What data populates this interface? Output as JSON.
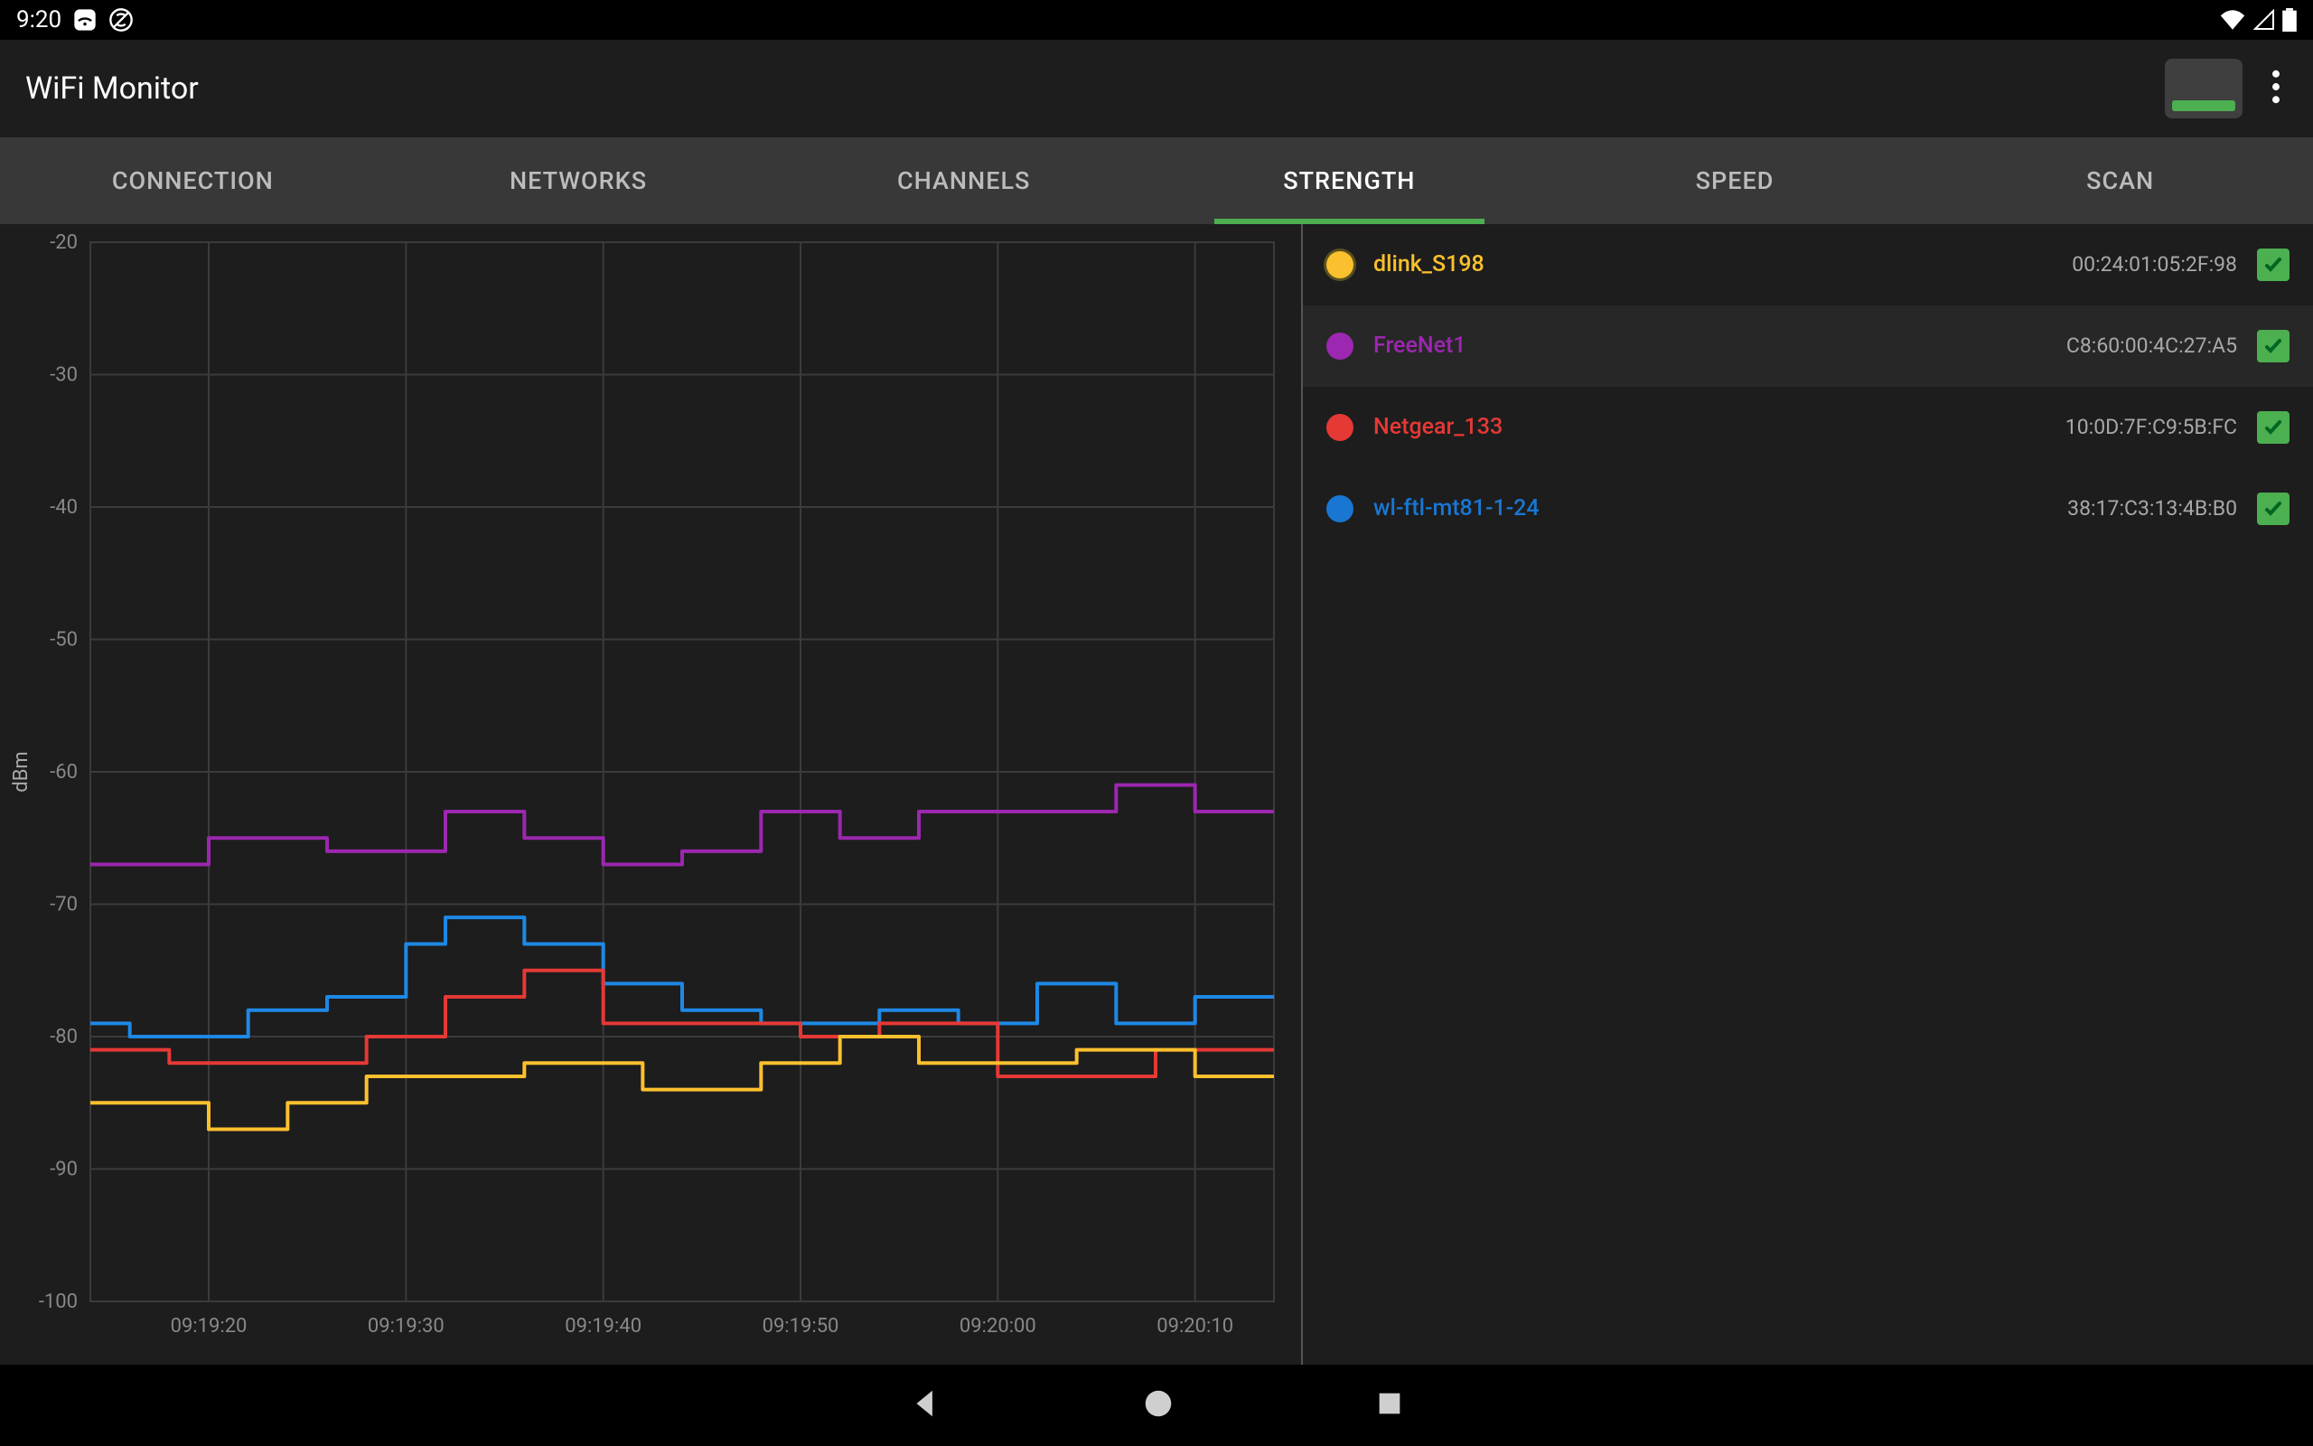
{
  "statusbar": {
    "time": "9:20"
  },
  "appbar": {
    "title": "WiFi Monitor"
  },
  "tabs": [
    {
      "id": "connection",
      "label": "CONNECTION",
      "active": false
    },
    {
      "id": "networks",
      "label": "NETWORKS",
      "active": false
    },
    {
      "id": "channels",
      "label": "CHANNELS",
      "active": false
    },
    {
      "id": "strength",
      "label": "STRENGTH",
      "active": true
    },
    {
      "id": "speed",
      "label": "SPEED",
      "active": false
    },
    {
      "id": "scan",
      "label": "SCAN",
      "active": false
    }
  ],
  "networks": [
    {
      "name": "dlink_S198",
      "mac": "00:24:01:05:2F:98",
      "color": "#fbc02d",
      "checked": true,
      "selected": false,
      "highlight": true
    },
    {
      "name": "FreeNet1",
      "mac": "C8:60:00:4C:27:A5",
      "color": "#9c27b0",
      "checked": true,
      "selected": true,
      "highlight": false
    },
    {
      "name": "Netgear_133",
      "mac": "10:0D:7F:C9:5B:FC",
      "color": "#e53935",
      "checked": true,
      "selected": false,
      "highlight": false
    },
    {
      "name": "wl-ftl-mt81-1-24",
      "mac": "38:17:C3:13:4B:B0",
      "color": "#1976d2",
      "checked": true,
      "selected": false,
      "highlight": false
    }
  ],
  "chart_data": {
    "type": "line",
    "title": "",
    "xlabel": "",
    "ylabel": "dBm",
    "ylim": [
      -100,
      -20
    ],
    "x": [
      "09:19:14",
      "09:19:16",
      "09:19:18",
      "09:19:20",
      "09:19:22",
      "09:19:24",
      "09:19:26",
      "09:19:28",
      "09:19:30",
      "09:19:32",
      "09:19:34",
      "09:19:36",
      "09:19:38",
      "09:19:40",
      "09:19:42",
      "09:19:44",
      "09:19:46",
      "09:19:48",
      "09:19:50",
      "09:19:52",
      "09:19:54",
      "09:19:56",
      "09:19:58",
      "09:20:00",
      "09:20:02",
      "09:20:04",
      "09:20:06",
      "09:20:08",
      "09:20:10",
      "09:20:12",
      "09:20:14"
    ],
    "x_ticks": [
      "09:19:20",
      "09:19:30",
      "09:19:40",
      "09:19:50",
      "09:20:00",
      "09:20:10"
    ],
    "y_ticks": [
      -20,
      -30,
      -40,
      -50,
      -60,
      -70,
      -80,
      -90,
      -100
    ],
    "series": [
      {
        "name": "FreeNet1",
        "color": "#9c27b0",
        "values": [
          -67,
          -67,
          -67,
          -65,
          -65,
          -65,
          -66,
          -66,
          -66,
          -63,
          -63,
          -65,
          -65,
          -67,
          -67,
          -66,
          -66,
          -63,
          -63,
          -65,
          -65,
          -63,
          -63,
          -63,
          -63,
          -63,
          -61,
          -61,
          -63,
          -63,
          -63
        ]
      },
      {
        "name": "wl-ftl-mt81-1-24",
        "color": "#1e88e5",
        "values": [
          -79,
          -80,
          -80,
          -80,
          -78,
          -78,
          -77,
          -77,
          -73,
          -71,
          -71,
          -73,
          -73,
          -76,
          -76,
          -78,
          -78,
          -79,
          -79,
          -79,
          -78,
          -78,
          -79,
          -79,
          -76,
          -76,
          -79,
          -79,
          -77,
          -77,
          -77
        ]
      },
      {
        "name": "Netgear_133",
        "color": "#e53935",
        "values": [
          -81,
          -81,
          -82,
          -82,
          -82,
          -82,
          -82,
          -80,
          -80,
          -77,
          -77,
          -75,
          -75,
          -79,
          -79,
          -79,
          -79,
          -79,
          -80,
          -80,
          -79,
          -79,
          -79,
          -83,
          -83,
          -83,
          -83,
          -81,
          -81,
          -81,
          -81
        ]
      },
      {
        "name": "dlink_S198",
        "color": "#fbc02d",
        "values": [
          -85,
          -85,
          -85,
          -87,
          -87,
          -85,
          -85,
          -83,
          -83,
          -83,
          -83,
          -82,
          -82,
          -82,
          -84,
          -84,
          -84,
          -82,
          -82,
          -80,
          -80,
          -82,
          -82,
          -82,
          -82,
          -81,
          -81,
          -81,
          -83,
          -83,
          -83
        ]
      }
    ]
  }
}
